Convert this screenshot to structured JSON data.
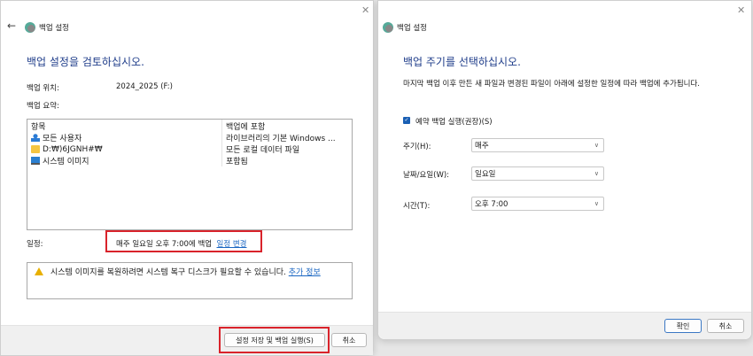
{
  "left": {
    "window_title": "백업 설정",
    "heading": "백업 설정을 검토하십시오.",
    "location_label": "백업 위치:",
    "location_value": "2024_2025 (F:)",
    "summary_label": "백업 요약:",
    "columns": [
      "항목",
      "백업에 포함"
    ],
    "rows": [
      {
        "icon": "users-icon",
        "item": "모든 사용자",
        "included": "라이브러리의 기본 Windows ..."
      },
      {
        "icon": "folder-icon",
        "item": "D:₩)6JGNH#₩",
        "included": "모든 로컬 데이터 파일"
      },
      {
        "icon": "monitor-icon",
        "item": "시스템 이미지",
        "included": "포함됨"
      }
    ],
    "schedule_label": "일정:",
    "schedule_value": "매주 일요일 오후 7:00에 백업",
    "change_schedule_link": "일정 변경",
    "warning_text": "시스템 이미지를 복원하려면 시스템 복구 디스크가 필요할 수 있습니다.",
    "more_info_link": "추가 정보",
    "save_run_button": "설정 저장 및 백업 실행(S)",
    "cancel_button": "취소"
  },
  "right": {
    "window_title": "백업 설정",
    "heading": "백업 주기를 선택하십시오.",
    "description": "마지막 백업 이후 만든 새 파일과 변경된 파일이 아래에 설정한 일정에 따라 백업에 추가됩니다.",
    "checkbox_label": "예약 백업 실행(권장)(S)",
    "checkbox_checked": true,
    "frequency_label": "주기(H):",
    "frequency_value": "매주",
    "day_label": "날짜/요일(W):",
    "day_value": "일요일",
    "time_label": "시간(T):",
    "time_value": "오후 7:00",
    "ok_button": "확인",
    "cancel_button": "취소"
  },
  "colors": {
    "heading": "#1f3d8a",
    "link": "#1a66c2",
    "highlight": "#d9232b",
    "checkbox": "#1a5fb4"
  }
}
